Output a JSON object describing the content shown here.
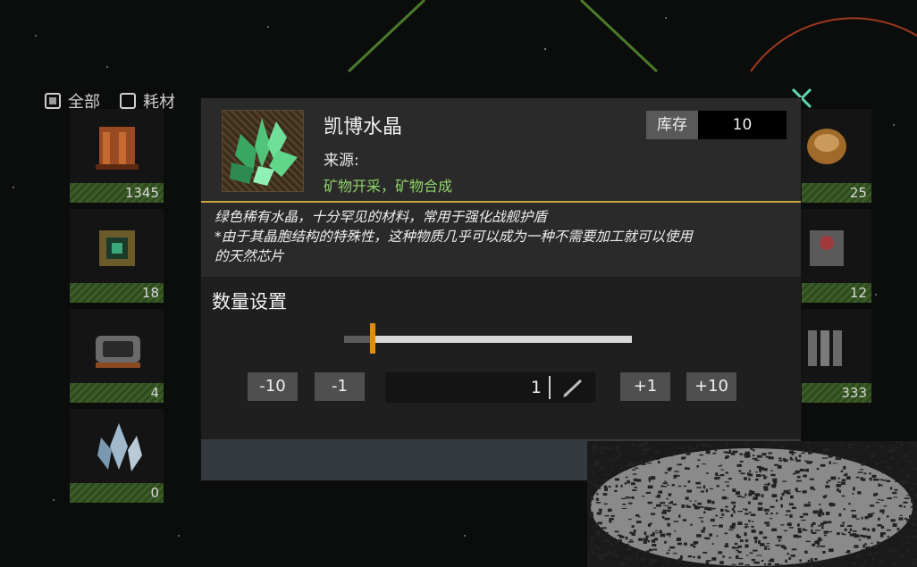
{
  "filters": [
    {
      "label": "全部",
      "checked": true
    },
    {
      "label": "耗材",
      "checked": false
    }
  ],
  "inventory_counts": {
    "left_col": [
      "1345",
      "18",
      "4",
      "0"
    ],
    "right_col": [
      "25",
      "12",
      "333"
    ]
  },
  "dialog": {
    "item_name": "凯博水晶",
    "source_label": "来源:",
    "source_value": "矿物开采，矿物合成",
    "stock_label": "库存",
    "stock_value": "10",
    "description": [
      "绿色稀有水晶，十分罕见的材料，常用于强化战舰护盾",
      "*由于其晶胞结构的特殊性，这种物质几乎可以成为一种不需要加工就可以使用",
      "的天然芯片"
    ],
    "quantity_title": "数量设置",
    "quantity_value": "1",
    "slider_fraction": 0.1,
    "buttons": {
      "minus10": "-10",
      "minus1": "-1",
      "plus1": "+1",
      "plus10": "+10"
    }
  },
  "colors": {
    "accent": "#c8a23a",
    "source": "#8fd36a",
    "handle": "#e08a1a",
    "close": "#5fd6b0"
  }
}
